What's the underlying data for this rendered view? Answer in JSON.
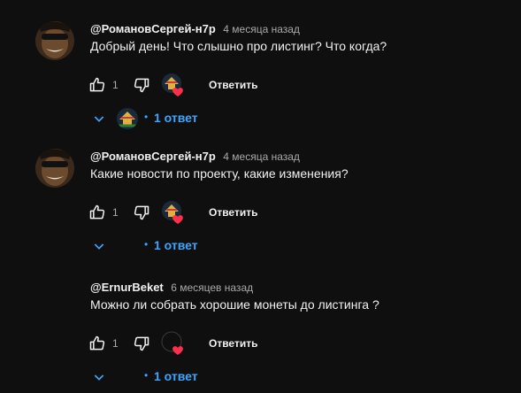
{
  "comments": [
    {
      "author": "@РомановСергей-н7р",
      "time": "4 месяца назад",
      "text": "Добрый день! Что слышно про листинг? Что когда?",
      "likes": "1",
      "reply_label": "Ответить",
      "replies_label": "1 ответ",
      "has_avatar": true
    },
    {
      "author": "@РомановСергей-н7р",
      "time": "4 месяца назад",
      "text": "Какие новости по проекту, какие изменения?",
      "likes": "1",
      "reply_label": "Ответить",
      "replies_label": "1 ответ",
      "has_avatar": true
    },
    {
      "author": "@ErnurBeket",
      "time": "6 месяцев назад",
      "text": "Можно ли собрать хорошие монеты до листинга ?",
      "likes": "1",
      "reply_label": "Ответить",
      "replies_label": "1 ответ",
      "has_avatar": false
    }
  ],
  "colors": {
    "background": "#0f0f0f",
    "text": "#f1f1f1",
    "secondary": "#aaaaaa",
    "link": "#3ea6ff",
    "heart": "#ff2e4c"
  },
  "icons": [
    "thumb-up-icon",
    "thumb-down-icon",
    "creator-heart-icon",
    "chevron-down-icon"
  ]
}
